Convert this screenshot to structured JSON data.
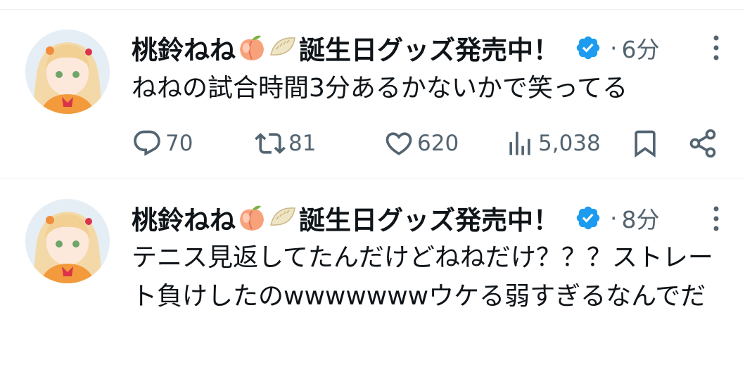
{
  "tweets": [
    {
      "author": "桃鈴ねね",
      "author_suffix": "誕生日グッズ発売中！",
      "emojis": [
        "peach-icon",
        "gyoza-icon"
      ],
      "separator": "·",
      "time": "6分",
      "text": "ねねの試合時間3分あるかないかで笑ってる",
      "stats": {
        "replies": "70",
        "retweets": "81",
        "likes": "620",
        "views": "5,038"
      }
    },
    {
      "author": "桃鈴ねね",
      "author_suffix": "誕生日グッズ発売中！",
      "emojis": [
        "peach-icon",
        "gyoza-icon"
      ],
      "separator": "·",
      "time": "8分",
      "text": "テニス見返してたんだけどねねだけ？？？ストレート負けしたのwwwwwwwウケる弱すぎるなんでだ"
    }
  ],
  "colors": {
    "verified": "#1d9bf0",
    "muted": "#536471",
    "text": "#0f1419",
    "divider": "#eff3f4"
  }
}
